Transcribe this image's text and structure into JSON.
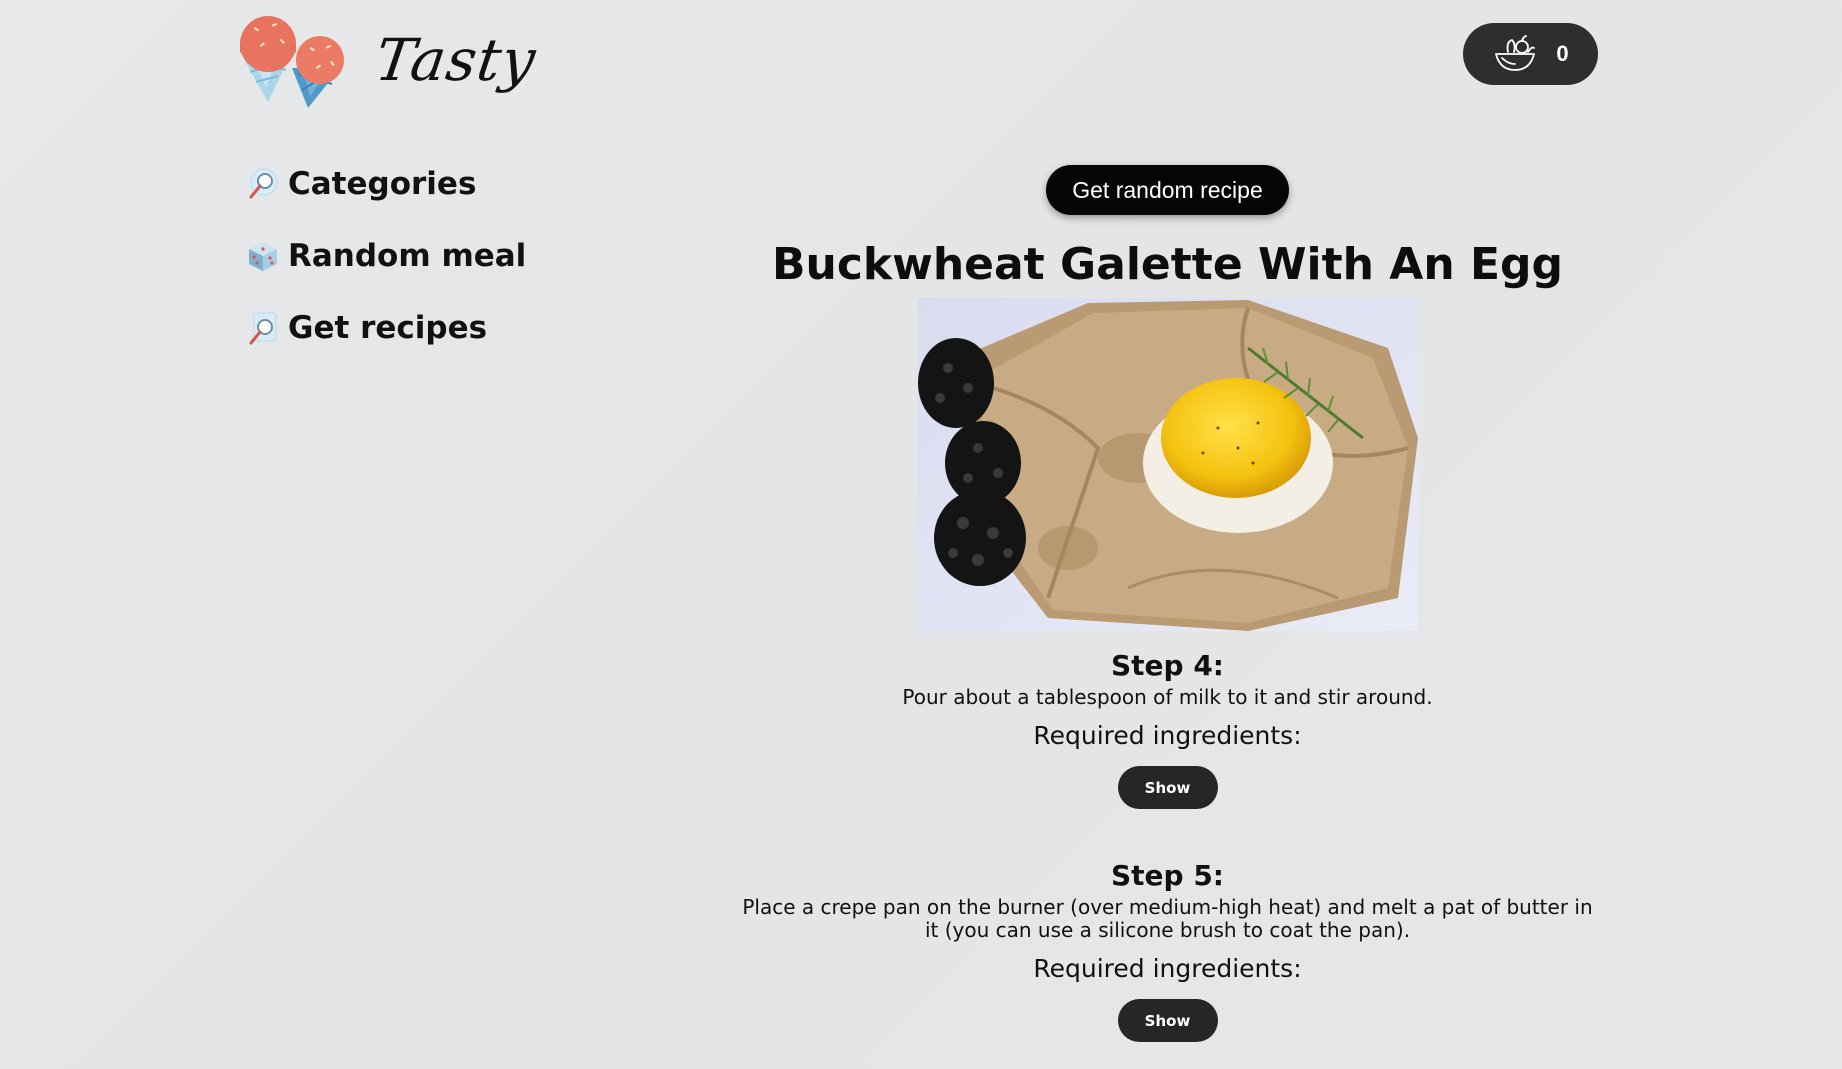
{
  "header": {
    "logo_icon": "ice-cream-cones-logo",
    "logo_text": "Tasty",
    "basket": {
      "icon": "basket-icon",
      "count": "0"
    }
  },
  "sidebar": {
    "items": [
      {
        "label": "Categories",
        "icon": "magnifier-icon"
      },
      {
        "label": "Random meal",
        "icon": "dice-icon"
      },
      {
        "label": "Get recipes",
        "icon": "magnifier-icon"
      }
    ]
  },
  "main": {
    "random_button": "Get random recipe",
    "recipe_title": "Buckwheat Galette With An Egg",
    "steps": [
      {
        "title": "Step 4:",
        "text": "Pour about a tablespoon of milk to it and stir around.",
        "ingredients_label": "Required ingredients:",
        "show_label": "Show"
      },
      {
        "title": "Step 5:",
        "text": "Place a crepe pan on the burner (over medium-high heat) and melt a pat of butter in it (you can use a silicone brush to coat the pan).",
        "ingredients_label": "Required ingredients:",
        "show_label": "Show"
      }
    ]
  },
  "colors": {
    "background": "#e5e6e7",
    "button_dark": "#050505",
    "basket_bg": "#2e2e2e",
    "show_button_bg": "#262626",
    "logo_coral": "#e8735f",
    "logo_blue": "#6fb3d6"
  }
}
